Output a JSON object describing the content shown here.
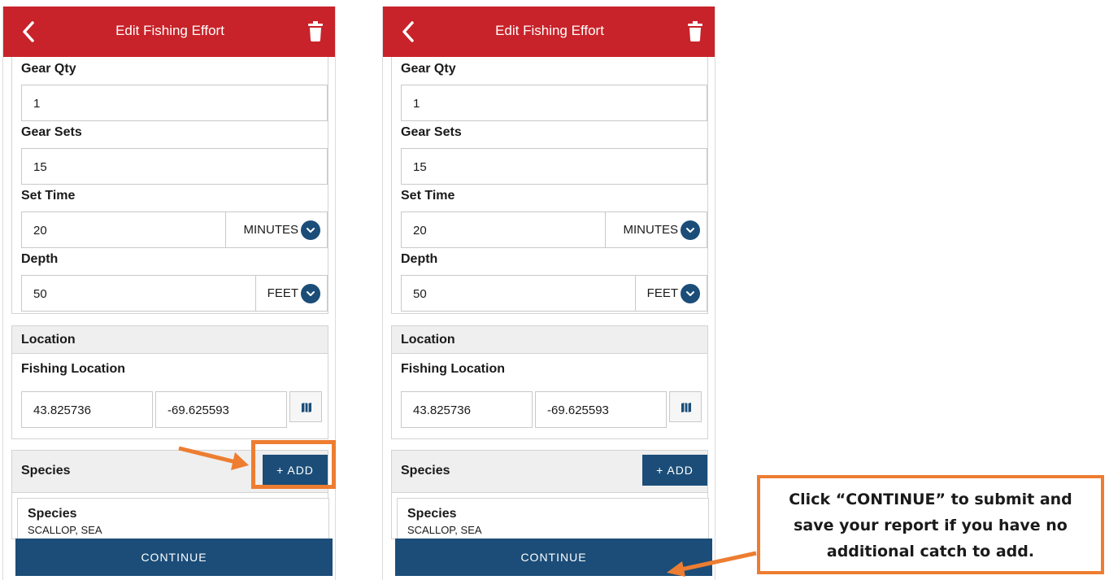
{
  "screens": [
    {
      "header": {
        "title": "Edit Fishing Effort",
        "back_icon": "chevron-left-icon",
        "delete_icon": "trash-icon"
      },
      "gear": {
        "gear_qty": {
          "label": "Gear Qty",
          "value": "1"
        },
        "gear_sets": {
          "label": "Gear Sets",
          "value": "15"
        },
        "set_time": {
          "label": "Set Time",
          "value": "20",
          "unit": "MINUTES"
        },
        "depth": {
          "label": "Depth",
          "value": "50",
          "unit": "FEET"
        }
      },
      "location": {
        "section_title": "Location",
        "field_label": "Fishing Location",
        "latitude": "43.825736",
        "longitude": "-69.625593",
        "map_icon": "map-icon"
      },
      "species": {
        "section_title": "Species",
        "add_button": "+ ADD",
        "item_label": "Species",
        "item_value": "SCALLOP, SEA"
      },
      "continue_button": "CONTINUE"
    },
    {
      "header": {
        "title": "Edit Fishing Effort",
        "back_icon": "chevron-left-icon",
        "delete_icon": "trash-icon"
      },
      "gear": {
        "gear_qty": {
          "label": "Gear Qty",
          "value": "1"
        },
        "gear_sets": {
          "label": "Gear Sets",
          "value": "15"
        },
        "set_time": {
          "label": "Set Time",
          "value": "20",
          "unit": "MINUTES"
        },
        "depth": {
          "label": "Depth",
          "value": "50",
          "unit": "FEET"
        }
      },
      "location": {
        "section_title": "Location",
        "field_label": "Fishing Location",
        "latitude": "43.825736",
        "longitude": "-69.625593",
        "map_icon": "map-icon"
      },
      "species": {
        "section_title": "Species",
        "add_button": "+ ADD",
        "item_label": "Species",
        "item_value": "SCALLOP, SEA"
      },
      "continue_button": "CONTINUE"
    }
  ],
  "annotation": {
    "callout_lines": [
      "Click “CONTINUE” to submit and",
      "save your report if you have no",
      "additional catch to add."
    ]
  },
  "colors": {
    "header_red": "#c8232a",
    "button_navy": "#1b4d78",
    "annotation_orange": "#ed7d31"
  }
}
